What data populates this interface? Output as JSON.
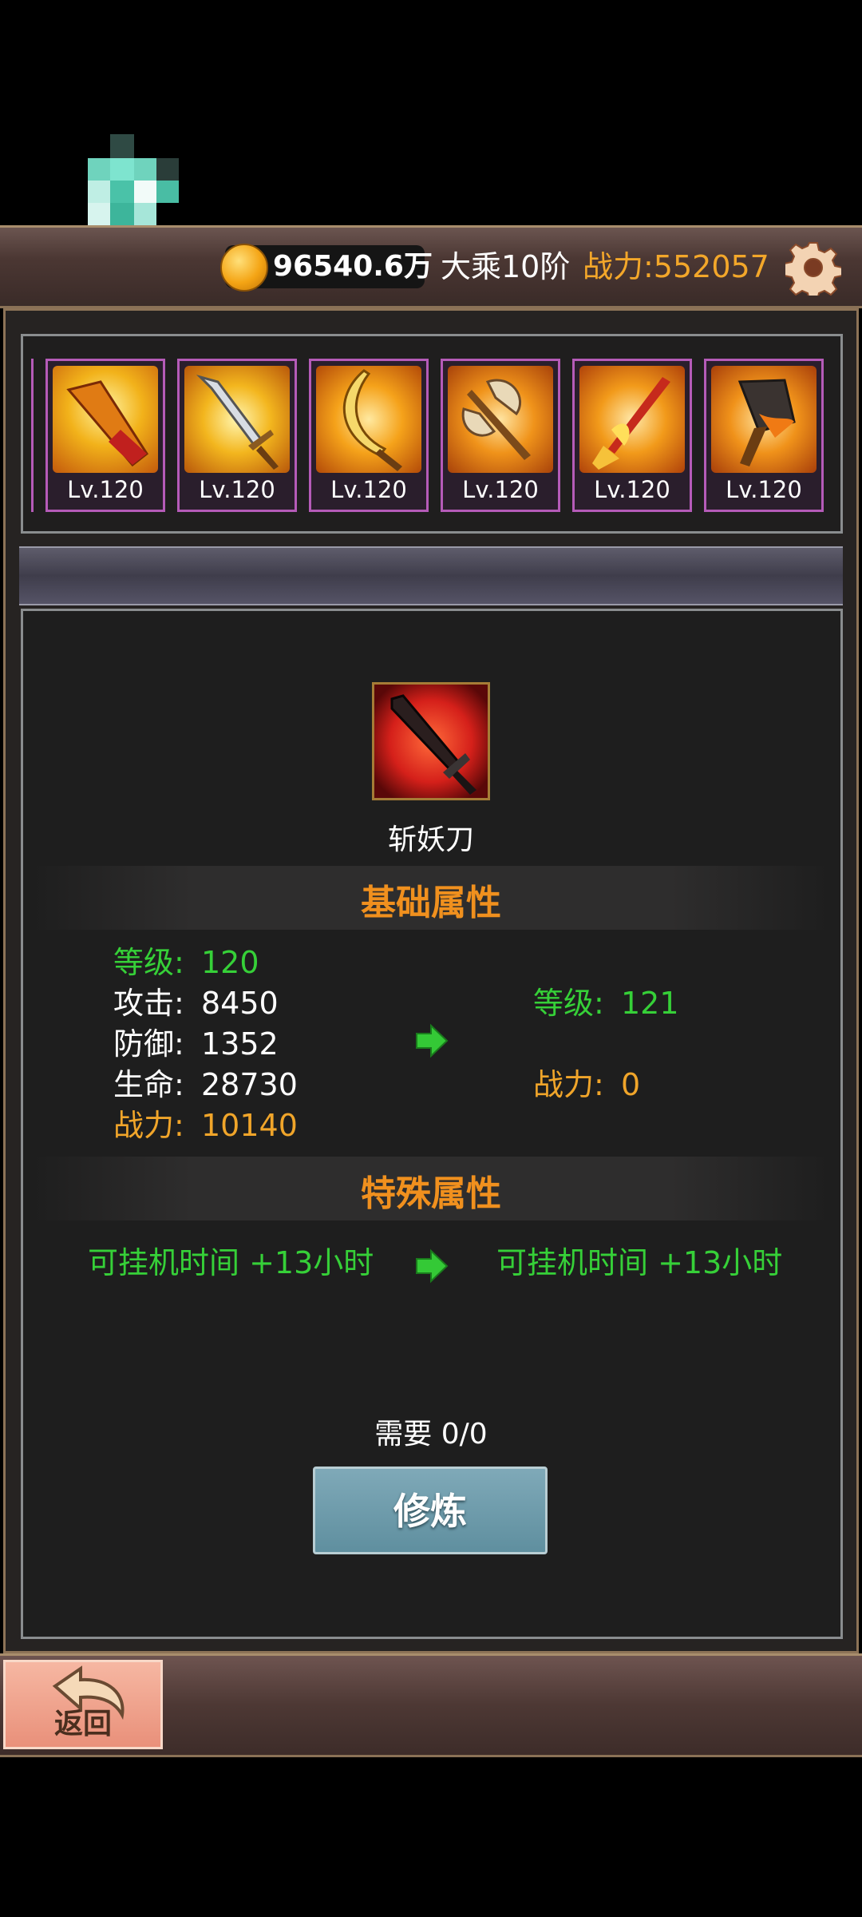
{
  "header": {
    "currency_value": "96540.6万",
    "realm": "大乘10阶",
    "combat_power": "战力:552057",
    "settings_icon": "gear-icon"
  },
  "equipment_slots": [
    {
      "level": "Lv.120",
      "icon": "horn-icon"
    },
    {
      "level": "Lv.120",
      "icon": "sword-icon"
    },
    {
      "level": "Lv.120",
      "icon": "curved-blade-icon"
    },
    {
      "level": "Lv.120",
      "icon": "battle-axe-icon"
    },
    {
      "level": "Lv.120",
      "icon": "fire-spear-icon"
    },
    {
      "level": "Lv.120",
      "icon": "war-hammer-icon"
    }
  ],
  "item": {
    "name": "斩妖刀",
    "icon": "demon-slaying-blade-icon"
  },
  "basic_section": {
    "title": "基础属性",
    "current": [
      {
        "label": "等级:",
        "value": "120"
      },
      {
        "label": "攻击:",
        "value": "8450"
      },
      {
        "label": "防御:",
        "value": "1352"
      },
      {
        "label": "生命:",
        "value": "28730"
      },
      {
        "label": "战力:",
        "value": "10140"
      }
    ],
    "next": [
      {
        "label": "等级:",
        "value": "121"
      },
      {
        "label": "战力:",
        "value": "0"
      }
    ]
  },
  "special_section": {
    "title": "特殊属性",
    "current": "可挂机时间 +13小时",
    "next": "可挂机时间 +13小时"
  },
  "requirement": "需要 0/0",
  "train_button": "修炼",
  "back_button": "返回",
  "colors": {
    "accent": "#f0901e",
    "green": "#36d038",
    "gold": "#f0a52a",
    "slot_border": "#b55bb8"
  }
}
